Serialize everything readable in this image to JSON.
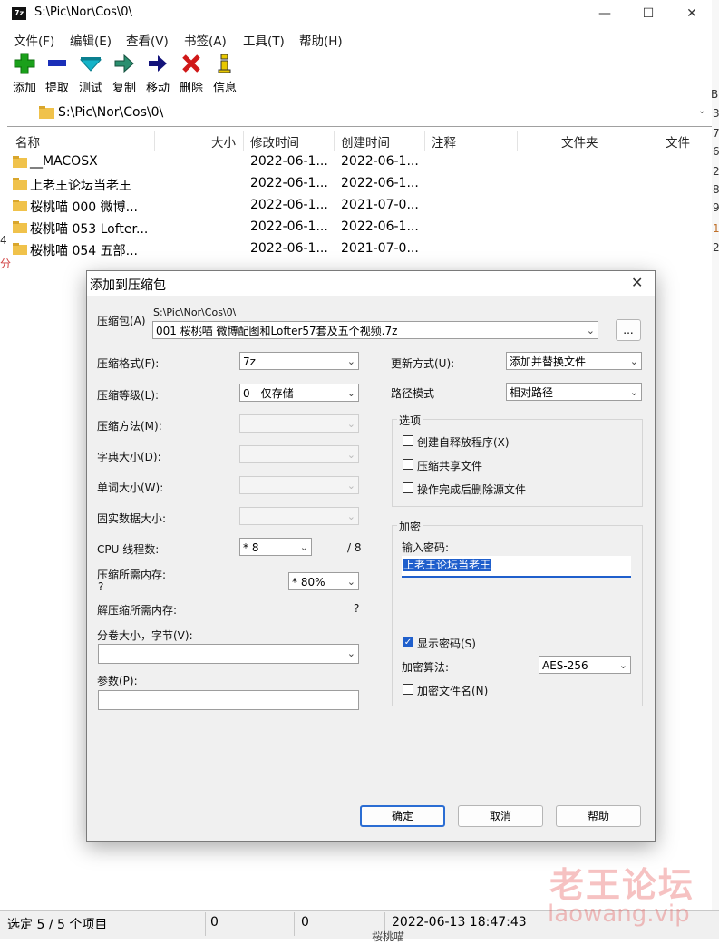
{
  "window": {
    "app_icon": "7z",
    "title": "S:\\Pic\\Nor\\Cos\\0\\",
    "controls": {
      "minimize": "—",
      "maximize": "☐",
      "close": "✕"
    }
  },
  "menu": [
    "文件(F)",
    "编辑(E)",
    "查看(V)",
    "书签(A)",
    "工具(T)",
    "帮助(H)"
  ],
  "toolbar": [
    {
      "label": "添加",
      "icon": "plus-icon",
      "color": "#1aa01a"
    },
    {
      "label": "提取",
      "icon": "minus-icon",
      "color": "#1a2fb8"
    },
    {
      "label": "测试",
      "icon": "check-icon",
      "color": "#15b3c8"
    },
    {
      "label": "复制",
      "icon": "copy-arrow-icon",
      "color": "#2a8f6f"
    },
    {
      "label": "移动",
      "icon": "move-arrow-icon",
      "color": "#13137a"
    },
    {
      "label": "删除",
      "icon": "delete-x-icon",
      "color": "#d01818"
    },
    {
      "label": "信息",
      "icon": "info-icon",
      "color": "#e8c800"
    }
  ],
  "address": {
    "path": "S:\\Pic\\Nor\\Cos\\0\\"
  },
  "columns": [
    "名称",
    "大小",
    "修改时间",
    "创建时间",
    "注释",
    "文件夹",
    "文件"
  ],
  "rows": [
    {
      "name": "__MACOSX",
      "modified": "2022-06-1...",
      "created": "2022-06-1..."
    },
    {
      "name": "上老王论坛当老王",
      "modified": "2022-06-1...",
      "created": "2022-06-1..."
    },
    {
      "name": "桜桃喵 000 微博...",
      "modified": "2022-06-1...",
      "created": "2021-07-0..."
    },
    {
      "name": "桜桃喵 053 Lofter...",
      "modified": "2022-06-1...",
      "created": "2022-06-1..."
    },
    {
      "name": "桜桃喵 054 五部...",
      "modified": "2022-06-1...",
      "created": "2021-07-0..."
    }
  ],
  "right_edge_fragments": [
    "B",
    "3",
    "7",
    "6",
    "2",
    "8",
    "9",
    "1",
    "2"
  ],
  "left_edge_fragments": [
    "4",
    "分"
  ],
  "status": {
    "selection": "选定 5 / 5 个项目",
    "size": "0",
    "packed": "0",
    "datetime": "2022-06-13 18:47:43",
    "behind_text": "桜桃喵"
  },
  "watermark": {
    "cn": "老王论坛",
    "en": "laowang.vip"
  },
  "dialog": {
    "title": "添加到压缩包",
    "close": "✕",
    "archive_label": "压缩包(A)",
    "archive_dir": "S:\\Pic\\Nor\\Cos\\0\\",
    "archive_name": "001 桜桃喵 微博配图和Lofter57套及五个视频.7z",
    "browse_label": "...",
    "left": {
      "format_label": "压缩格式(F):",
      "format_value": "7z",
      "level_label": "压缩等级(L):",
      "level_value": "0 - 仅存储",
      "method_label": "压缩方法(M):",
      "dict_label": "字典大小(D):",
      "word_label": "单词大小(W):",
      "solid_label": "固实数据大小:",
      "cpu_label": "CPU 线程数:",
      "cpu_value": "* 8",
      "cpu_total": "/ 8",
      "mem_label": "压缩所需内存:",
      "mem_q": "?",
      "mem_value": "* 80%",
      "demem_label": "解压缩所需内存:",
      "demem_q": "?",
      "volume_label": "分卷大小，字节(V):",
      "volume_value": "",
      "params_label": "参数(P):",
      "params_value": ""
    },
    "right": {
      "update_label": "更新方式(U):",
      "update_value": "添加并替换文件",
      "path_label": "路径模式",
      "path_value": "相对路径",
      "options_title": "选项",
      "opt_sfx": "创建自释放程序(X)",
      "opt_shared": "压缩共享文件",
      "opt_delete": "操作完成后删除源文件",
      "encrypt_title": "加密",
      "password_label": "输入密码:",
      "password_value": "上老王论坛当老王",
      "show_password": "显示密码(S)",
      "algo_label": "加密算法:",
      "algo_value": "AES-256",
      "encrypt_names": "加密文件名(N)"
    },
    "buttons": {
      "ok": "确定",
      "cancel": "取消",
      "help": "帮助"
    }
  }
}
